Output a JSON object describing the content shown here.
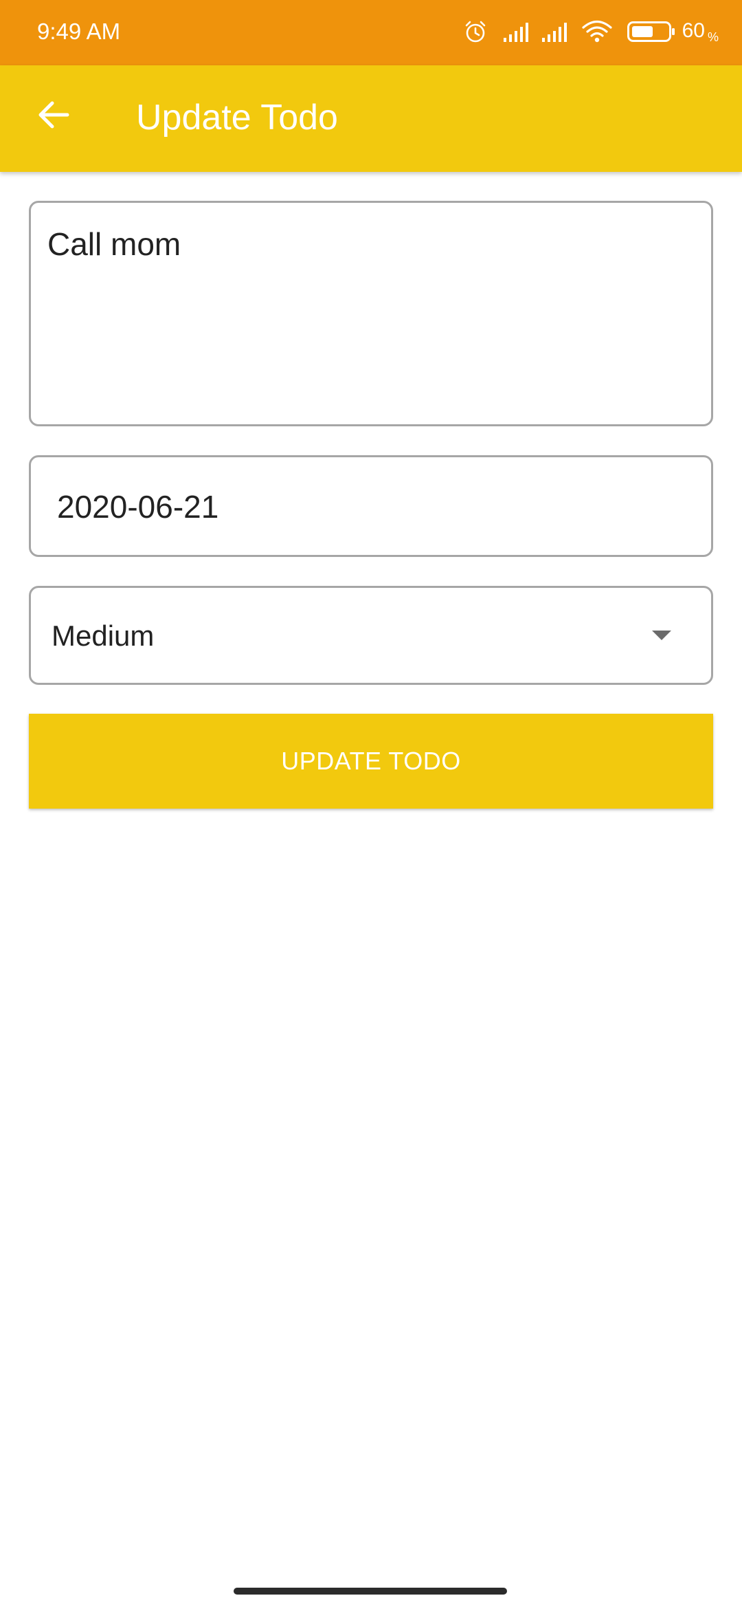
{
  "status_bar": {
    "time": "9:49 AM",
    "battery_percent": "60",
    "battery_unit": "%",
    "battery_level": 0.6,
    "icons": [
      "alarm-icon",
      "signal-icon",
      "signal-icon",
      "wifi-icon",
      "battery-icon"
    ]
  },
  "app_bar": {
    "title": "Update Todo",
    "back_icon": "arrow-left-icon"
  },
  "form": {
    "title_value": "Call mom",
    "date_value": "2020-06-21",
    "priority_selected": "Medium",
    "priority_icon": "dropdown-arrow-icon"
  },
  "actions": {
    "update_label": "UPDATE TODO"
  },
  "colors": {
    "status_bar": "#EF930C",
    "accent": "#F2C90E",
    "field_border": "#A6A6A6",
    "text": "#222222"
  }
}
